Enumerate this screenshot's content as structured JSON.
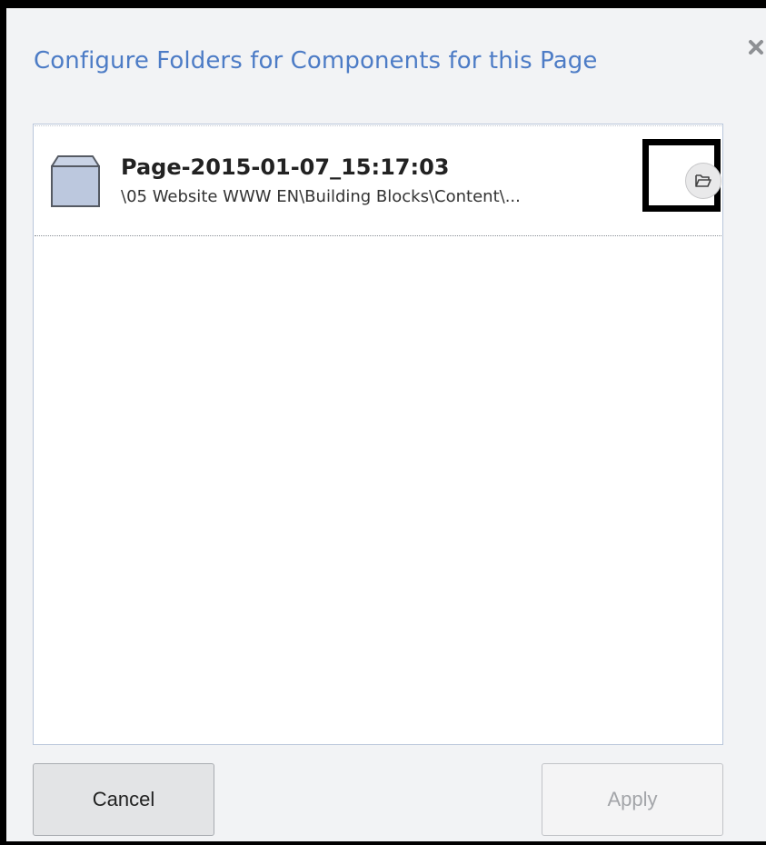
{
  "dialog": {
    "title": "Configure Folders for Components for this Page",
    "close_icon": "close-icon"
  },
  "list": {
    "items": [
      {
        "icon": "page-box-icon",
        "title": "Page-2015-01-07_15:17:03",
        "path": "\\05 Website WWW EN\\Building Blocks\\Content\\...",
        "action_icon": "folder-open-icon"
      }
    ]
  },
  "buttons": {
    "cancel_label": "Cancel",
    "apply_label": "Apply"
  },
  "colors": {
    "title": "#4d7cc6",
    "dialog_background": "#f2f3f5",
    "panel_border": "#b9c6da",
    "highlight": "#000000",
    "apply_disabled_text": "#a3a5a9"
  }
}
